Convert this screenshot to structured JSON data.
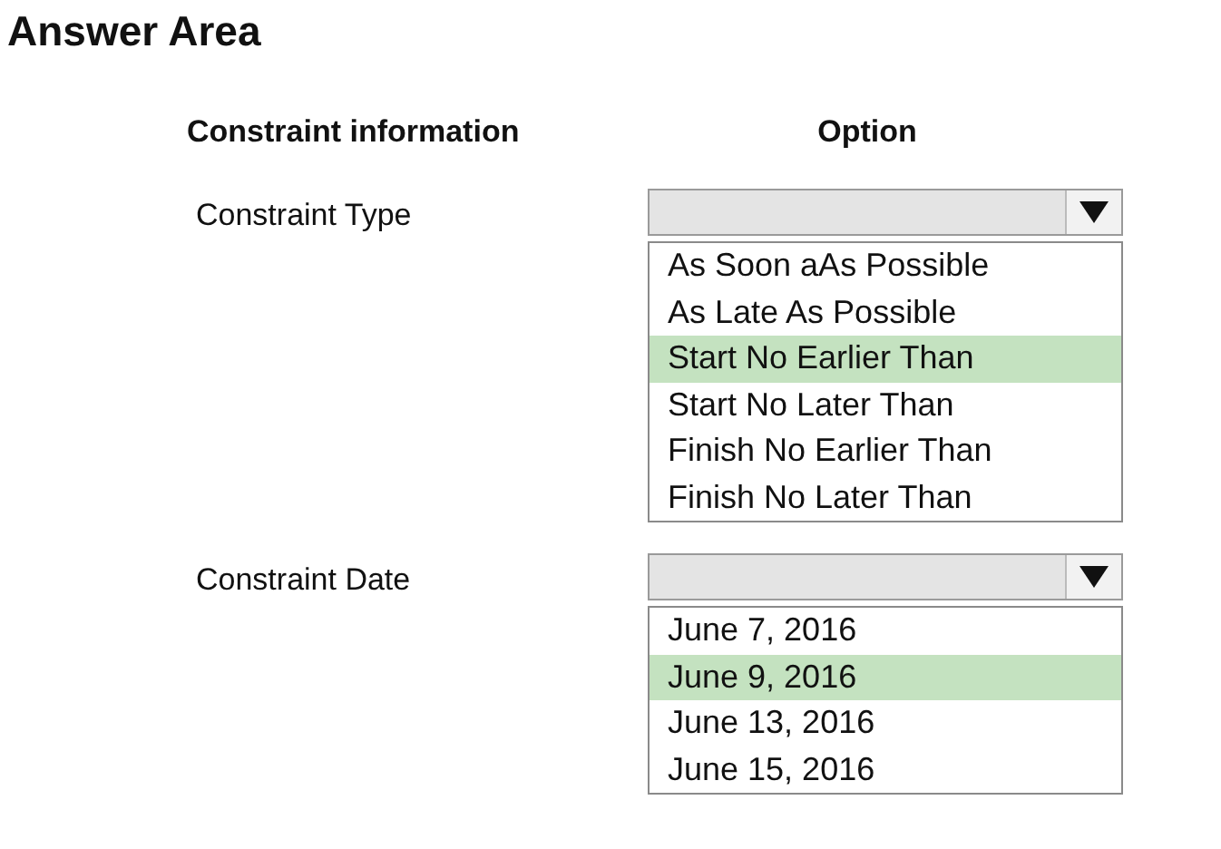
{
  "title": "Answer Area",
  "headers": [
    "Constraint information",
    "Option"
  ],
  "rows": [
    {
      "label": "Constraint Type",
      "options": [
        {
          "label": "As Soon aAs Possible",
          "selected": false
        },
        {
          "label": "As Late As Possible",
          "selected": false
        },
        {
          "label": "Start No Earlier Than",
          "selected": true
        },
        {
          "label": "Start No Later Than",
          "selected": false
        },
        {
          "label": "Finish No Earlier Than",
          "selected": false
        },
        {
          "label": "Finish No Later Than",
          "selected": false
        }
      ]
    },
    {
      "label": "Constraint Date",
      "options": [
        {
          "label": "June 7, 2016",
          "selected": false
        },
        {
          "label": "June 9, 2016",
          "selected": true
        },
        {
          "label": "June 13, 2016",
          "selected": false
        },
        {
          "label": "June 15, 2016",
          "selected": false
        }
      ]
    }
  ]
}
